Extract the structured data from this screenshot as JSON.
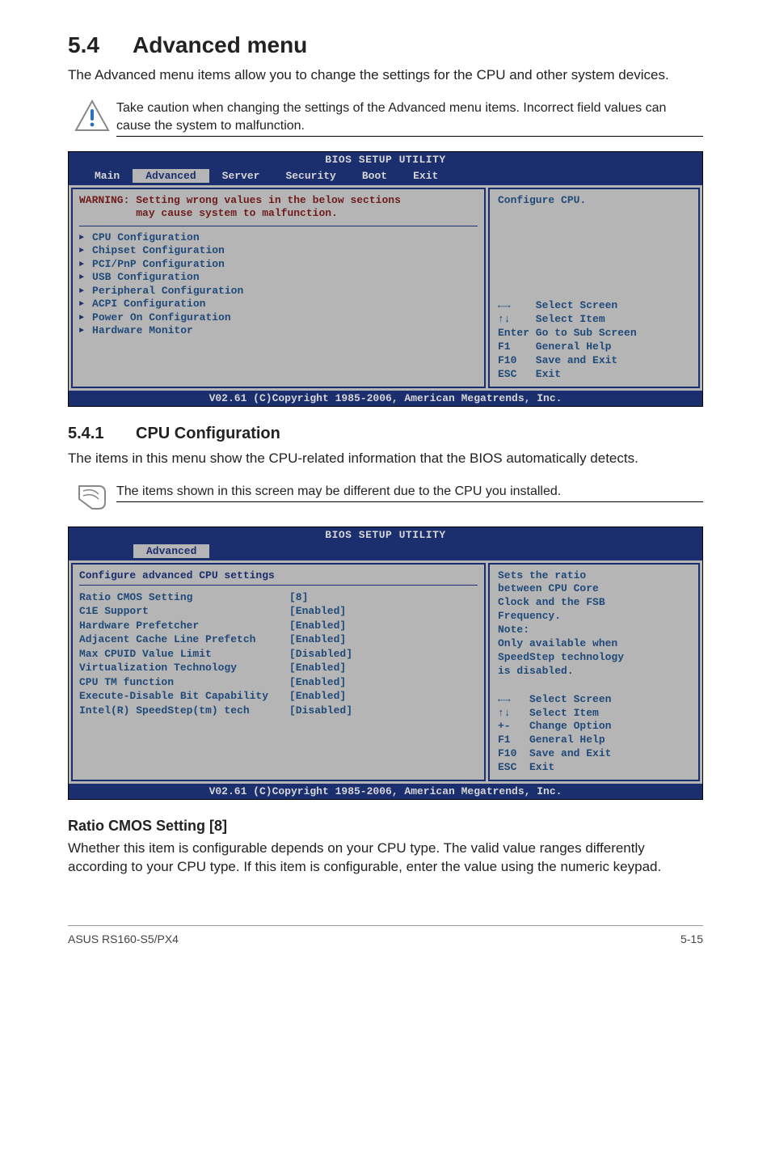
{
  "section": {
    "num": "5.4",
    "title": "Advanced menu"
  },
  "intro": "The Advanced menu items allow you to change the settings for the CPU and other system devices.",
  "caution_text": "Take caution when changing the settings of the Advanced menu items. Incorrect field values can cause the system to malfunction.",
  "bios1": {
    "title": "BIOS SETUP UTILITY",
    "menus": [
      "Main",
      "Advanced",
      "Server",
      "Security",
      "Boot",
      "Exit"
    ],
    "active_menu": "Advanced",
    "warning_l1": "WARNING: Setting wrong values in the below sections",
    "warning_l2": "         may cause system to malfunction.",
    "items": [
      "CPU Configuration",
      "Chipset Configuration",
      "PCI/PnP Configuration",
      "USB Configuration",
      "Peripheral Configuration",
      "ACPI Configuration",
      "Power On Configuration",
      "Hardware Monitor"
    ],
    "help_top": "Configure CPU.",
    "help_keys": "←→    Select Screen\n↑↓    Select Item\nEnter Go to Sub Screen\nF1    General Help\nF10   Save and Exit\nESC   Exit",
    "footer": "V02.61 (C)Copyright 1985-2006, American Megatrends, Inc."
  },
  "sub": {
    "num": "5.4.1",
    "title": "CPU Configuration"
  },
  "sub_intro": "The items in this menu show the CPU-related information that the BIOS automatically detects.",
  "note_text": "The items shown in this screen may be different due to the CPU you installed.",
  "bios2": {
    "title": "BIOS SETUP UTILITY",
    "active_menu": "Advanced",
    "panel_title": "Configure advanced CPU settings",
    "settings": [
      {
        "k": "Ratio CMOS Setting",
        "v": "[8]"
      },
      {
        "k": "C1E Support",
        "v": "[Enabled]"
      },
      {
        "k": "Hardware Prefetcher",
        "v": "[Enabled]"
      },
      {
        "k": "Adjacent Cache Line Prefetch",
        "v": "[Enabled]"
      },
      {
        "k": "Max CPUID Value Limit",
        "v": "[Disabled]"
      },
      {
        "k": "Virtualization Technology",
        "v": "[Enabled]"
      },
      {
        "k": "CPU TM function",
        "v": "[Enabled]"
      },
      {
        "k": "Execute-Disable Bit Capability",
        "v": "[Enabled]"
      },
      {
        "k": "",
        "v": ""
      },
      {
        "k": "Intel(R) SpeedStep(tm) tech",
        "v": "[Disabled]"
      }
    ],
    "help_top": "Sets the ratio\nbetween CPU Core\nClock and the FSB\nFrequency.\nNote:\nOnly available when\nSpeedStep technology\nis disabled.",
    "help_keys": "←→   Select Screen\n↑↓   Select Item\n+-   Change Option\nF1   General Help\nF10  Save and Exit\nESC  Exit",
    "footer": "V02.61 (C)Copyright 1985-2006, American Megatrends, Inc."
  },
  "setting_heading": "Ratio CMOS Setting [8]",
  "setting_desc": "Whether this item is configurable depends on your CPU type. The valid value ranges differently according to your CPU type. If this item is configurable, enter the value using the numeric keypad.",
  "footer": {
    "left": "ASUS RS160-S5/PX4",
    "right": "5-15"
  },
  "chart_data": {
    "type": "table",
    "title": "Configure advanced CPU settings",
    "rows": [
      [
        "Ratio CMOS Setting",
        "[8]"
      ],
      [
        "C1E Support",
        "[Enabled]"
      ],
      [
        "Hardware Prefetcher",
        "[Enabled]"
      ],
      [
        "Adjacent Cache Line Prefetch",
        "[Enabled]"
      ],
      [
        "Max CPUID Value Limit",
        "[Disabled]"
      ],
      [
        "Virtualization Technology",
        "[Enabled]"
      ],
      [
        "CPU TM function",
        "[Enabled]"
      ],
      [
        "Execute-Disable Bit Capability",
        "[Enabled]"
      ],
      [
        "Intel(R) SpeedStep(tm) tech",
        "[Disabled]"
      ]
    ]
  }
}
